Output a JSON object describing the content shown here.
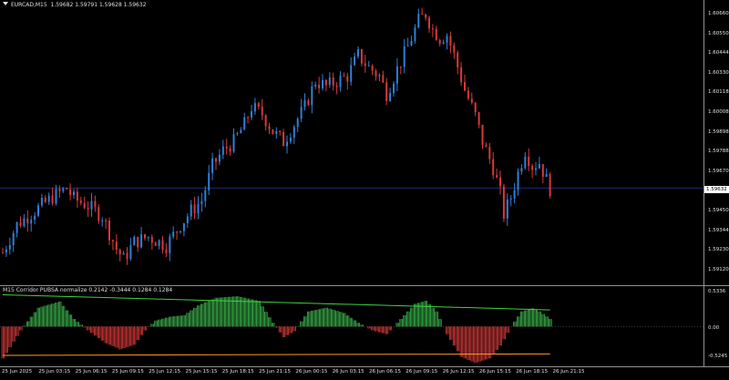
{
  "chart": {
    "symbol_line": "EURCAD,M15",
    "ohlc_line": "1.59682 1.59791 1.59628 1.59632",
    "current_price": "1.59632"
  },
  "indicator": {
    "title": "M15 Corridor PUBSA normalize 0.2142 -0.3444 0.1284 0.1284"
  },
  "price_axis": [
    "1.60660",
    "1.60550",
    "1.60444",
    "1.60330",
    "1.60118",
    "1.60008",
    "1.59898",
    "1.59788",
    "1.59670",
    "1.59564",
    "1.59450",
    "1.59344",
    "1.59230",
    "1.59120"
  ],
  "indicator_axis": [
    "0.5336",
    "0.00",
    "-0.5245"
  ],
  "time_axis": [
    "25 Jun 2025",
    "25 Jun 03:15",
    "25 Jun 06:15",
    "25 Jun 09:15",
    "25 Jun 12:15",
    "25 Jun 15:15",
    "25 Jun 18:15",
    "25 Jun 21:15",
    "26 Jun 00:15",
    "26 Jun 03:15",
    "26 Jun 06:15",
    "26 Jun 09:15",
    "26 Jun 12:15",
    "26 Jun 15:15",
    "26 Jun 18:15",
    "26 Jun 21:15"
  ],
  "colors": {
    "background": "#000000",
    "bull": "#2f7fd8",
    "bear": "#d63a3a",
    "hist_up": "#39b54a",
    "hist_down": "#d63a3a",
    "upper_line": "#3fd23f",
    "lower_line": "#ff9a1f",
    "current_line": "#1c2e6e"
  },
  "chart_data": {
    "type": "candlestick",
    "title": "EURCAD,M15",
    "ylim": [
      1.5907,
      1.6072
    ],
    "close_path": [
      [
        0,
        1.5926
      ],
      [
        4,
        1.5942
      ],
      [
        9,
        1.595
      ],
      [
        14,
        1.5958
      ],
      [
        18,
        1.5963
      ],
      [
        20,
        1.5957
      ],
      [
        24,
        1.5953
      ],
      [
        28,
        1.5947
      ],
      [
        32,
        1.5928
      ],
      [
        34,
        1.5922
      ],
      [
        37,
        1.5932
      ],
      [
        41,
        1.5935
      ],
      [
        46,
        1.593
      ],
      [
        50,
        1.5942
      ],
      [
        53,
        1.595
      ],
      [
        56,
        1.5956
      ],
      [
        59,
        1.5976
      ],
      [
        62,
        1.5985
      ],
      [
        65,
        1.599
      ],
      [
        68,
        1.6
      ],
      [
        70,
        1.601
      ],
      [
        73,
        1.6006
      ],
      [
        76,
        1.5996
      ],
      [
        79,
        1.599
      ],
      [
        82,
        1.6
      ],
      [
        85,
        1.601
      ],
      [
        88,
        1.6025
      ],
      [
        91,
        1.6022
      ],
      [
        94,
        1.6025
      ],
      [
        97,
        1.6028
      ],
      [
        100,
        1.604
      ],
      [
        103,
        1.6033
      ],
      [
        106,
        1.6028
      ],
      [
        108,
        1.6018
      ],
      [
        111,
        1.6032
      ],
      [
        114,
        1.6045
      ],
      [
        117,
        1.606
      ],
      [
        119,
        1.6064
      ],
      [
        121,
        1.6055
      ],
      [
        123,
        1.605
      ],
      [
        125,
        1.6052
      ],
      [
        127,
        1.604
      ],
      [
        130,
        1.602
      ],
      [
        133,
        1.6005
      ],
      [
        135,
        1.599
      ],
      [
        138,
        1.5975
      ],
      [
        140,
        1.596
      ],
      [
        141,
        1.5948
      ],
      [
        143,
        1.5958
      ],
      [
        145,
        1.5972
      ],
      [
        147,
        1.5985
      ],
      [
        149,
        1.5976
      ],
      [
        151,
        1.5978
      ],
      [
        153,
        1.5968
      ],
      [
        154,
        1.5963
      ]
    ],
    "indicator": {
      "name": "M15 Corridor PUBSA normalize",
      "values_printed": [
        0.2142,
        -0.3444,
        0.1284,
        0.1284
      ],
      "ylim": [
        -0.5245,
        0.5336
      ],
      "hist_path": [
        [
          0,
          -0.42
        ],
        [
          5,
          -0.05
        ],
        [
          10,
          0.25
        ],
        [
          16,
          0.33
        ],
        [
          20,
          0.1
        ],
        [
          24,
          -0.05
        ],
        [
          29,
          -0.22
        ],
        [
          33,
          -0.3
        ],
        [
          37,
          -0.24
        ],
        [
          40,
          -0.05
        ],
        [
          43,
          0.08
        ],
        [
          47,
          0.13
        ],
        [
          51,
          0.15
        ],
        [
          55,
          0.28
        ],
        [
          60,
          0.38
        ],
        [
          66,
          0.4
        ],
        [
          72,
          0.34
        ],
        [
          76,
          0.05
        ],
        [
          79,
          -0.14
        ],
        [
          82,
          -0.06
        ],
        [
          86,
          0.2
        ],
        [
          91,
          0.25
        ],
        [
          96,
          0.18
        ],
        [
          100,
          0.05
        ],
        [
          104,
          -0.05
        ],
        [
          108,
          -0.1
        ],
        [
          111,
          0.05
        ],
        [
          116,
          0.3
        ],
        [
          119,
          0.34
        ],
        [
          122,
          0.2
        ],
        [
          125,
          -0.1
        ],
        [
          129,
          -0.4
        ],
        [
          133,
          -0.48
        ],
        [
          137,
          -0.42
        ],
        [
          140,
          -0.25
        ],
        [
          143,
          0.0
        ],
        [
          146,
          0.2
        ],
        [
          149,
          0.24
        ],
        [
          151,
          0.2
        ],
        [
          154,
          0.1
        ]
      ],
      "upper_line": [
        [
          0,
          0.42
        ],
        [
          154,
          0.22
        ]
      ],
      "lower_line": [
        [
          0,
          -0.38
        ],
        [
          154,
          -0.36
        ]
      ]
    }
  }
}
